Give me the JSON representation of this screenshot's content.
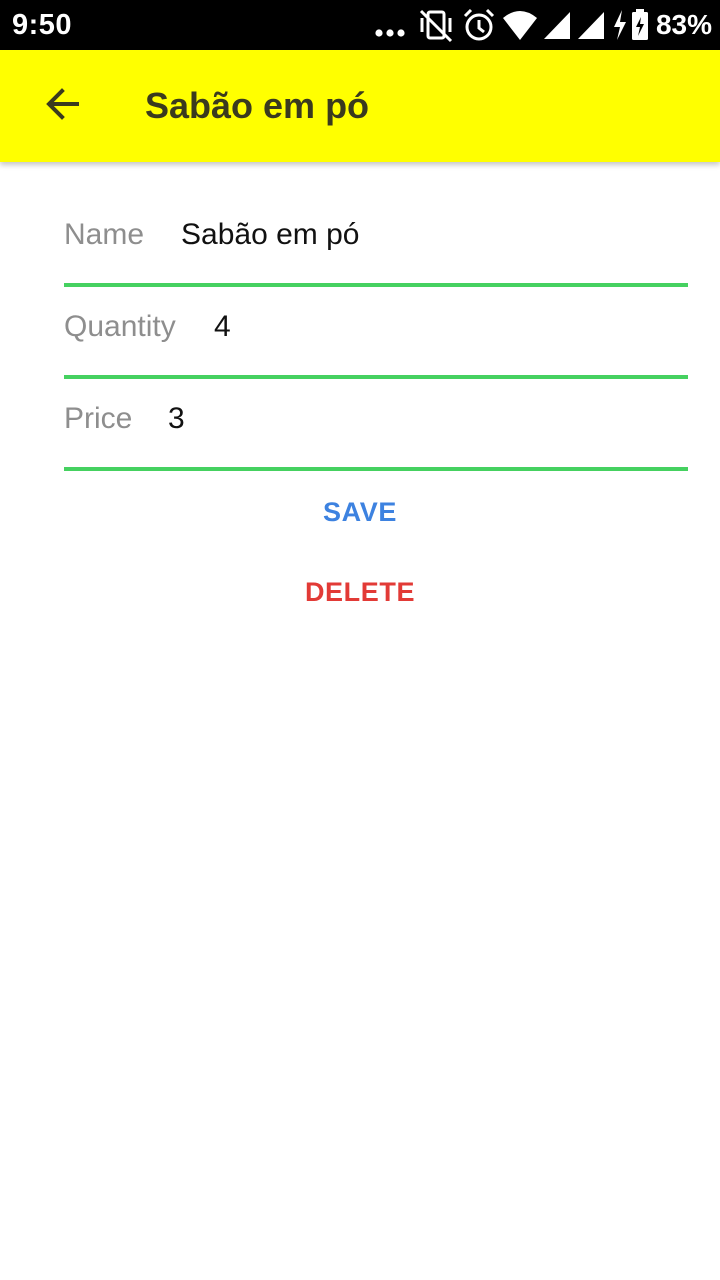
{
  "status_bar": {
    "time": "9:50",
    "icons": [
      "more-dots-icon",
      "vibrate-off-icon",
      "alarm-icon",
      "wifi-icon",
      "signal-icon",
      "signal-icon",
      "charging-icon",
      "battery-icon"
    ],
    "battery_percent": "83%"
  },
  "app_bar": {
    "background_color": "#ffff00",
    "back_icon": "arrow-back-icon",
    "title": "Sabão em pó"
  },
  "form": {
    "accent_color": "#45d160",
    "fields": [
      {
        "label": "Name",
        "value": "Sabão em pó"
      },
      {
        "label": "Quantity",
        "value": "4"
      },
      {
        "label": "Price",
        "value": "3"
      }
    ]
  },
  "actions": {
    "save_label": "SAVE",
    "save_color": "#3d82e0",
    "delete_label": "DELETE",
    "delete_color": "#e23a36"
  }
}
